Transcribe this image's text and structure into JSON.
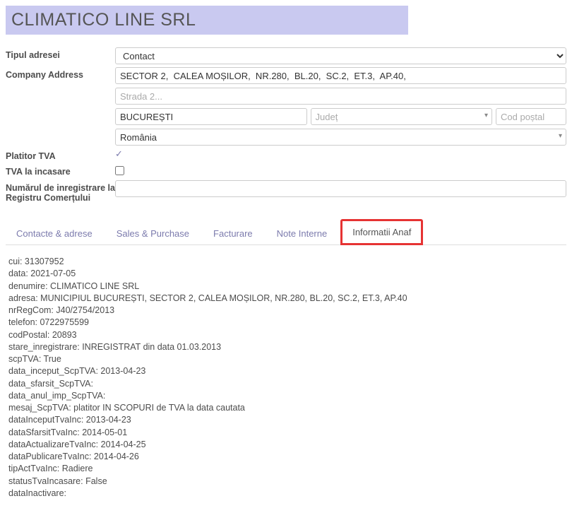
{
  "company_name": "CLIMATICO LINE SRL",
  "labels": {
    "tipul_adresei": "Tipul adresei",
    "company_address": "Company Address",
    "platitor_tva": "Platitor TVA",
    "tva_incasare": "TVA la incasare",
    "nr_inregistrare": "Numărul de inregistrare la Registru Comerțului"
  },
  "address_type_value": "Contact",
  "address": {
    "line1": "SECTOR 2,  CALEA MOȘILOR,  NR.280,  BL.20,  SC.2,  ET.3,  AP.40,",
    "line2_placeholder": "Strada 2...",
    "city": "BUCUREȘTI",
    "judet_placeholder": "Județ",
    "codpostal_placeholder": "Cod poștal",
    "country": "România"
  },
  "platitor_tva_checked": true,
  "tva_incasare_checked": false,
  "nr_inregistrare_value": "",
  "tabs": {
    "contacte": "Contacte & adrese",
    "sales": "Sales & Purchase",
    "facturare": "Facturare",
    "note": "Note Interne",
    "anaf": "Informatii Anaf"
  },
  "anaf_info": {
    "l0": "cui: 31307952",
    "l1": "data: 2021-07-05",
    "l2": "denumire: CLIMATICO LINE SRL",
    "l3": "adresa: MUNICIPIUL BUCUREȘTI, SECTOR 2, CALEA MOȘILOR, NR.280, BL.20, SC.2, ET.3, AP.40",
    "l4": "nrRegCom: J40/2754/2013",
    "l5": "telefon: 0722975599",
    "l6": "codPostal: 20893",
    "l7": "stare_inregistrare: INREGISTRAT din data 01.03.2013",
    "l8": "scpTVA: True",
    "l9": "data_inceput_ScpTVA: 2013-04-23",
    "l10": "data_sfarsit_ScpTVA:",
    "l11": "data_anul_imp_ScpTVA:",
    "l12": "mesaj_ScpTVA: platitor IN SCOPURI de TVA la data cautata",
    "l13": "dataInceputTvaInc: 2013-04-23",
    "l14": "dataSfarsitTvaInc: 2014-05-01",
    "l15": "dataActualizareTvaInc: 2014-04-25",
    "l16": "dataPublicareTvaInc: 2014-04-26",
    "l17": "tipActTvaInc: Radiere",
    "l18": "statusTvaIncasare: False",
    "l19": "dataInactivare:"
  }
}
